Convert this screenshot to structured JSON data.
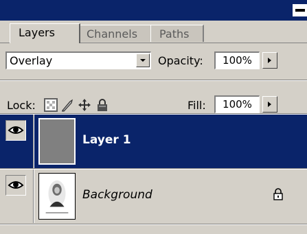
{
  "panel": {
    "tabs": [
      {
        "label": "Layers",
        "active": true
      },
      {
        "label": "Channels",
        "active": false
      },
      {
        "label": "Paths",
        "active": false
      }
    ],
    "blend_mode": "Overlay",
    "opacity_label": "Opacity:",
    "opacity_value": "100%",
    "lock_label": "Lock:",
    "fill_label": "Fill:",
    "fill_value": "100%",
    "lock_icons": [
      "lock-transparent-pixels-icon",
      "lock-image-pixels-icon",
      "lock-position-icon",
      "lock-all-icon"
    ]
  },
  "layers": [
    {
      "name": "Layer 1",
      "selected": true,
      "visible": true,
      "thumbnail": "gray-fill"
    },
    {
      "name": "Background",
      "selected": false,
      "visible": true,
      "locked": true,
      "thumbnail": "portrait-photo"
    }
  ],
  "colors": {
    "titlebar": "#0a246a",
    "selection": "#0a246a",
    "panel_bg": "#d4d0c8",
    "layer1_thumb": "#808080"
  }
}
